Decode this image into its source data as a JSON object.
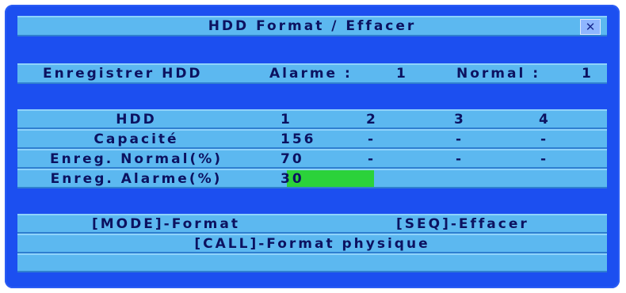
{
  "title": "HDD Format / Effacer",
  "close_icon": "close-icon",
  "record": {
    "label": "Enregistrer HDD",
    "alarm_label": "Alarme :",
    "alarm_value": "1",
    "normal_label": "Normal :",
    "normal_value": "1"
  },
  "table": {
    "header": [
      "HDD",
      "1",
      "2",
      "3",
      "4"
    ],
    "rows": [
      {
        "label": "Capacité",
        "cells": [
          "156",
          "-",
          "-",
          "-"
        ]
      },
      {
        "label": "Enreg. Normal(%)",
        "cells": [
          "70",
          "-",
          "-",
          "-"
        ]
      },
      {
        "label": "Enreg. Alarme(%)",
        "cells": [
          "30"
        ]
      }
    ]
  },
  "actions": {
    "format": "[MODE]-Format",
    "erase": "[SEQ]-Effacer",
    "physical": "[CALL]-Format physique"
  },
  "colors": {
    "background": "#1c4ff0",
    "bar": "#5cb8f0",
    "text": "#0c1260",
    "selection": "#2bd23a"
  }
}
